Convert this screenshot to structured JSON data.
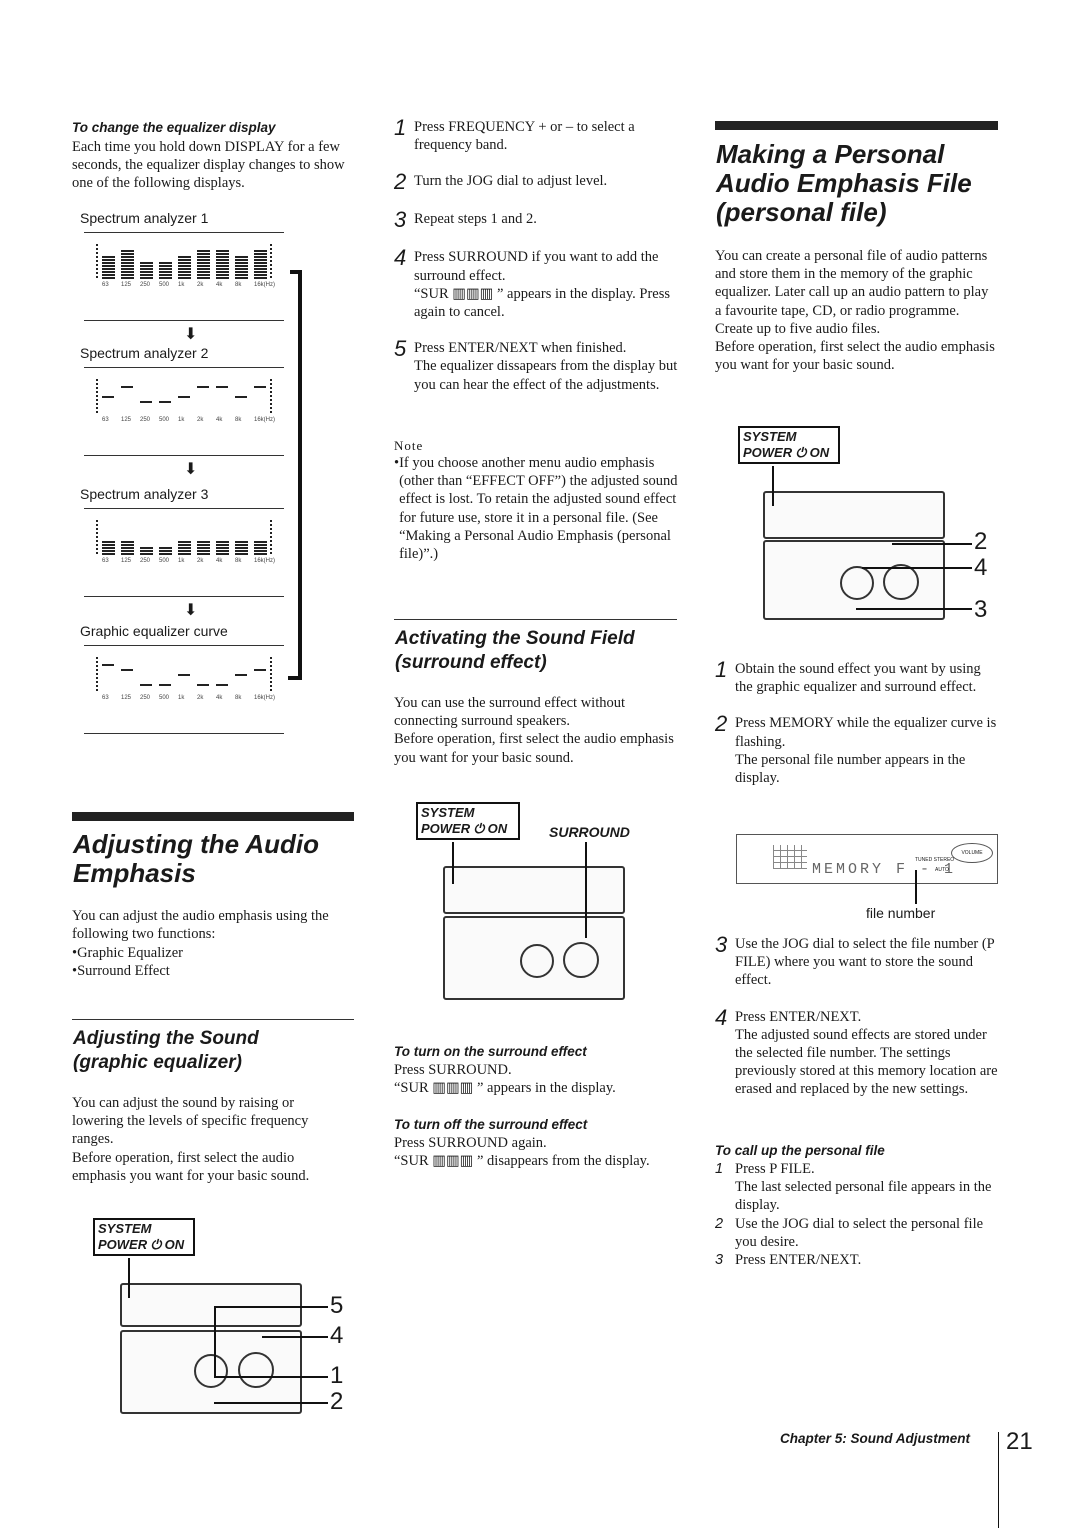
{
  "col1": {
    "eq_display_title": "To change the equalizer display",
    "eq_display_text": "Each time you hold down DISPLAY for a few seconds, the equalizer display changes to show one of the following displays.",
    "displays": [
      {
        "label": "Spectrum analyzer 1",
        "type": "bars",
        "levels": [
          8,
          10,
          6,
          6,
          8,
          10,
          10,
          8,
          10
        ]
      },
      {
        "label": "Spectrum analyzer 2",
        "type": "dashes",
        "levels": [
          3,
          5,
          2,
          2,
          3,
          5,
          5,
          3,
          5
        ]
      },
      {
        "label": "Spectrum analyzer 3",
        "type": "stacks",
        "levels": [
          5,
          5,
          3,
          3,
          5,
          5,
          5,
          5,
          5
        ]
      },
      {
        "label": "Graphic equalizer curve",
        "type": "dashes",
        "levels": [
          5,
          4,
          1,
          1,
          3,
          1,
          1,
          3,
          4
        ]
      }
    ],
    "freq_labels": [
      "63",
      "125",
      "250",
      "500",
      "1k",
      "2k",
      "4k",
      "8k",
      "16k(Hz)"
    ],
    "section_title": "Adjusting the Audio Emphasis",
    "section_text": "You can adjust the audio emphasis using the following two functions:",
    "functions": [
      "Graphic Equalizer",
      "Surround Effect"
    ],
    "sub_title": "Adjusting the Sound (graphic equalizer)",
    "sub_text1": "You can adjust the sound by raising or lowering the levels of specific frequency ranges.",
    "sub_text2": "Before operation, first select the audio emphasis you want for your basic sound.",
    "badge": [
      "SYSTEM",
      "POWER ⏻ ON"
    ],
    "callouts": [
      "5",
      "4",
      "1",
      "2"
    ]
  },
  "col2": {
    "steps": [
      {
        "n": "1",
        "text": "Press FREQUENCY + or – to select a frequency band."
      },
      {
        "n": "2",
        "text": "Turn the JOG dial to adjust level."
      },
      {
        "n": "3",
        "text": "Repeat steps 1 and 2."
      },
      {
        "n": "4",
        "text": "Press SURROUND if you want to add the surround effect.",
        "extra": "“SUR ▥▥▥ ” appears in the display. Press again to cancel."
      },
      {
        "n": "5",
        "text": "Press ENTER/NEXT when finished.",
        "extra": "The equalizer dissapears from the display but you can hear the effect of the adjustments."
      }
    ],
    "note_label": "Note",
    "note_text": "If you choose another menu audio emphasis (other than “EFFECT OFF”) the adjusted sound effect is lost. To retain the adjusted sound effect for future use, store it in a personal file. (See “Making a Personal Audio Emphasis (personal file)”.)",
    "section_title": "Activating the Sound Field (surround effect)",
    "text1": "You can use the surround effect without connecting surround speakers.",
    "text2": "Before operation, first select the audio emphasis you want for your basic sound.",
    "badge": [
      "SYSTEM",
      "POWER ⏻ ON"
    ],
    "surround_label": "SURROUND",
    "on_title": "To turn on the surround effect",
    "on_text": [
      "Press SURROUND.",
      "“SUR ▥▥▥ ” appears in the display."
    ],
    "off_title": "To turn off the surround effect",
    "off_text": [
      "Press SURROUND again.",
      "“SUR ▥▥▥ ” disappears from the display."
    ]
  },
  "col3": {
    "section_title": "Making a Personal Audio Emphasis File (personal file)",
    "text1": "You can create a personal file of audio patterns and store them in the memory of the graphic equalizer. Later call up an audio pattern to play a favourite tape, CD, or radio programme. Create up to five audio files.",
    "text2": "Before operation, first select the audio emphasis you want for your basic sound.",
    "badge": [
      "SYSTEM",
      "POWER ⏻ ON"
    ],
    "callouts": [
      "2",
      "4",
      "3"
    ],
    "steps": [
      {
        "n": "1",
        "text": "Obtain the sound effect you want by using the graphic equalizer and surround effect."
      },
      {
        "n": "2",
        "text": "Press MEMORY while the equalizer curve is flashing.",
        "extra": "The personal file number appears in the display."
      },
      {
        "n": "3",
        "text": "Use the JOG dial to select the file number (P FILE) where you want to store the sound effect."
      },
      {
        "n": "4",
        "text": "Press ENTER/NEXT.",
        "extra": "The adjusted sound effects are stored under the selected file number. The settings previously stored at this memory location are erased and replaced by the new settings."
      }
    ],
    "display_text": "MEMORY  F - 1",
    "display_small": [
      "TUNED STEREO",
      "AUTO",
      "VOLUME"
    ],
    "file_number_label": "file number",
    "call_title": "To call up the personal file",
    "call_steps": [
      {
        "n": "1",
        "text": "Press P FILE.",
        "extra": "The last selected personal file appears in the display."
      },
      {
        "n": "2",
        "text": "Use the JOG dial to select the personal file you desire."
      },
      {
        "n": "3",
        "text": "Press ENTER/NEXT."
      }
    ]
  },
  "footer": {
    "chapter": "Chapter 5: Sound Adjustment",
    "page": "21"
  }
}
